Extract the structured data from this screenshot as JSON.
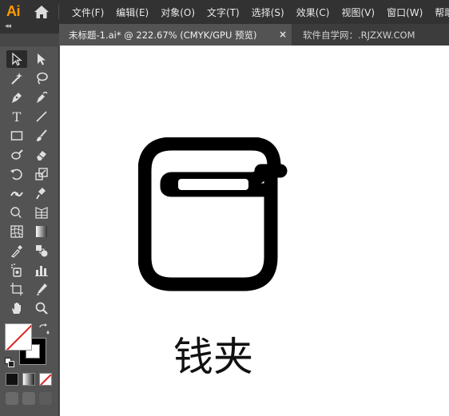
{
  "app": {
    "logo_text": "Ai"
  },
  "menu": [
    "文件(F)",
    "编辑(E)",
    "对象(O)",
    "文字(T)",
    "选择(S)",
    "效果(C)",
    "视图(V)",
    "窗口(W)",
    "帮助("
  ],
  "tabs": {
    "active_label": "未标题-1.ai* @ 222.67% (CMYK/GPU 预览)",
    "close_glyph": "×",
    "second_label": "软件自学网：.RJZXW.COM"
  },
  "toolpanel": {
    "collapse_glyph": "◂◂",
    "type_tool_glyph": "T"
  },
  "canvas": {
    "caption": "钱夹"
  },
  "colors": {
    "menubar_bg": "#323232",
    "panel_bg": "#535353",
    "canvas_bg": "#ffffff",
    "artwork_stroke": "#000000",
    "logo": "#ff9a00",
    "none_slash": "#e02020"
  },
  "icons": [
    "home-icon",
    "selection-tool-icon",
    "direct-selection-tool-icon",
    "magic-wand-icon",
    "lasso-icon",
    "pen-tool-icon",
    "curvature-tool-icon",
    "type-tool-icon",
    "line-segment-icon",
    "rectangle-tool-icon",
    "paintbrush-icon",
    "shaper-tool-icon",
    "eraser-icon",
    "rotate-tool-icon",
    "scale-tool-icon",
    "width-tool-icon",
    "puppet-warp-icon",
    "shape-builder-icon",
    "perspective-grid-icon",
    "mesh-tool-icon",
    "gradient-tool-icon",
    "eyedropper-icon",
    "blend-tool-icon",
    "symbol-sprayer-icon",
    "column-graph-icon",
    "artboard-tool-icon",
    "slice-tool-icon",
    "hand-tool-icon",
    "zoom-tool-icon",
    "swap-fill-stroke-icon",
    "default-colors-icon",
    "wallet-icon"
  ]
}
